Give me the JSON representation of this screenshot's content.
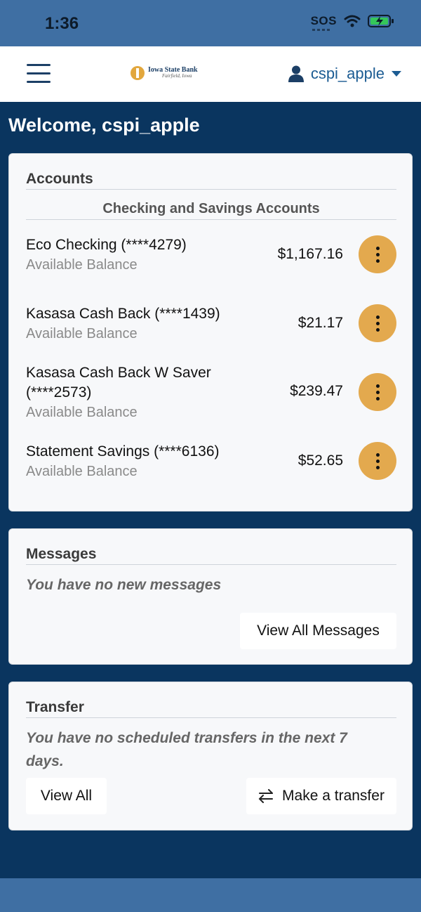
{
  "status_bar": {
    "time": "1:36",
    "sos": "SOS"
  },
  "header": {
    "logo_name": "Iowa State Bank",
    "logo_location": "Fairfield, Iowa",
    "username": "cspi_apple"
  },
  "welcome": "Welcome, cspi_apple",
  "accounts_card": {
    "title": "Accounts",
    "section": "Checking and Savings Accounts",
    "items": [
      {
        "name": "Eco Checking (****4279)",
        "name2": "",
        "label": "Available Balance",
        "balance": "$1,167.16"
      },
      {
        "name": "Kasasa Cash Back (****1439)",
        "name2": "",
        "label": "Available Balance",
        "balance": "$21.17"
      },
      {
        "name": "Kasasa Cash Back W Saver",
        "name2": "(****2573)",
        "label": "Available Balance",
        "balance": "$239.47"
      },
      {
        "name": "Statement Savings (****6136)",
        "name2": "",
        "label": "Available Balance",
        "balance": "$52.65"
      }
    ]
  },
  "messages_card": {
    "title": "Messages",
    "empty": "You have no new messages",
    "button": "View All Messages"
  },
  "transfer_card": {
    "title": "Transfer",
    "empty_line1": "You have no scheduled transfers in the next 7",
    "empty_line2": "days.",
    "view_all": "View All",
    "make_transfer": "Make a transfer"
  },
  "colors": {
    "navy": "#0a355f",
    "header_blue": "#3f6fa3",
    "accent_gold": "#e3a94e",
    "link_blue": "#1c5c93"
  },
  "icons": [
    "wifi-icon",
    "battery-charging-icon",
    "hamburger-icon",
    "user-icon",
    "caret-down-icon",
    "more-vertical-icon",
    "transfer-arrows-icon"
  ]
}
